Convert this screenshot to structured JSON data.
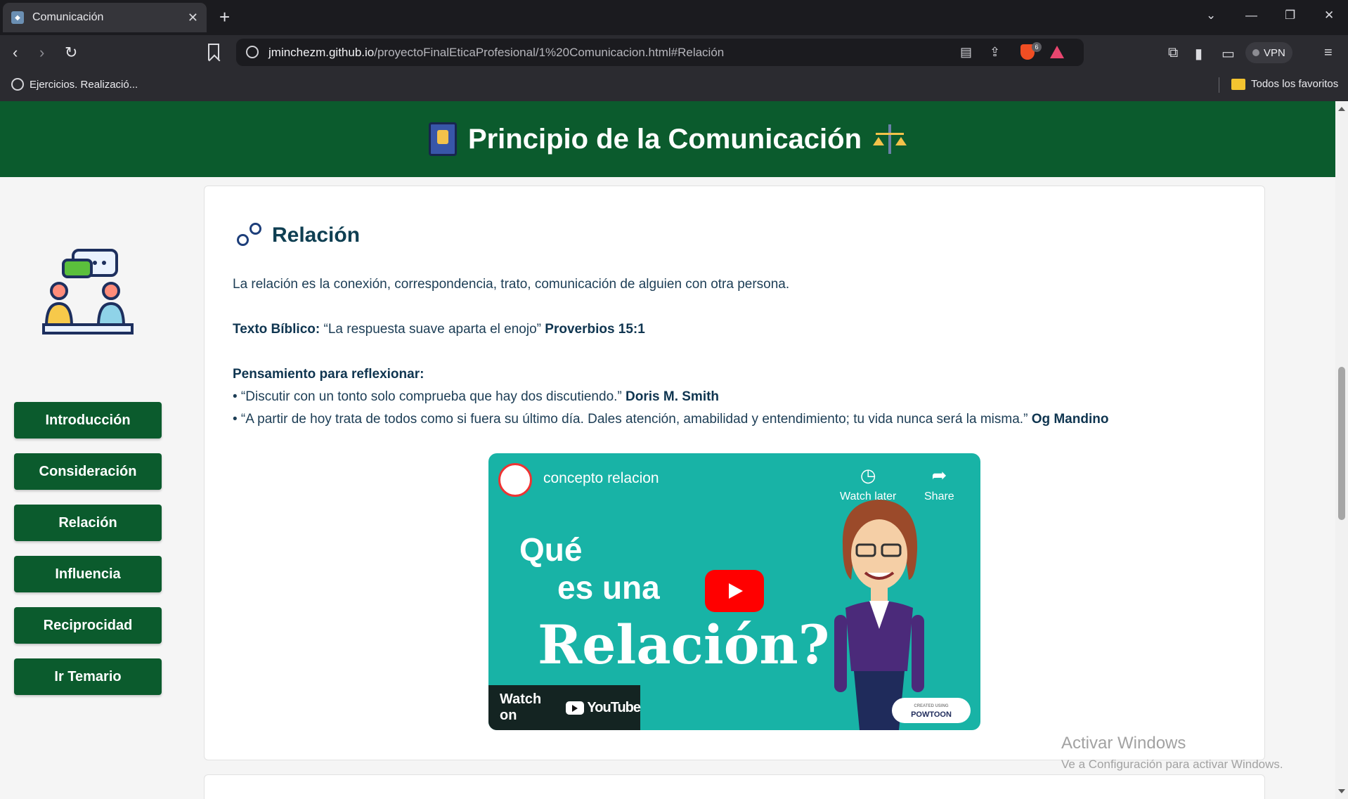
{
  "browser": {
    "tab_title": "Comunicación",
    "new_tab": "+",
    "url_host": "jminchezm.github.io",
    "url_path": "/proyectoFinalEticaProfesional/1%20Comunicacion.html#Relación",
    "shields_count": "6",
    "vpn_label": "VPN",
    "bookmark_item": "Ejercicios. Realizació...",
    "bookmarks_folder": "Todos los favoritos"
  },
  "header": {
    "title": "Principio de la Comunicación"
  },
  "sidebar": {
    "items": [
      {
        "label": "Introducción"
      },
      {
        "label": "Consideración"
      },
      {
        "label": "Relación"
      },
      {
        "label": "Influencia"
      },
      {
        "label": "Reciprocidad"
      },
      {
        "label": "Ir Temario"
      }
    ]
  },
  "section": {
    "title": "Relación",
    "intro": "La relación es la conexión, correspondencia, trato, comunicación de alguien con otra persona.",
    "bible_label": "Texto Bíblico:",
    "bible_quote": "“La respuesta suave aparta el enojo”",
    "bible_ref": "Proverbios 15:1",
    "thought_label": "Pensamiento para reflexionar:",
    "quote1": "• “Discutir con un tonto solo comprueba que hay dos discutiendo.”",
    "quote1_author": "Doris M. Smith",
    "quote2": "• “A partir de hoy trata de todos como si fuera su último día. Dales atención, amabilidad y entendimiento; tu vida nunca será la misma.”",
    "quote2_author": "Og Mandino"
  },
  "video": {
    "title": "concepto relacion",
    "watch_later": "Watch later",
    "share": "Share",
    "line1": "Qué",
    "line2": "es una",
    "line3": "Relación?",
    "watch_on": "Watch on",
    "youtube": "YouTube",
    "powtoon_small": "CREATED USING",
    "powtoon": "POWTOON"
  },
  "os_watermark": {
    "title": "Activar Windows",
    "subtitle": "Ve a Configuración para activar Windows."
  },
  "colors": {
    "header_green": "#0b5b2d",
    "video_teal": "#18b3a6",
    "text_navy": "#1c3d55"
  }
}
